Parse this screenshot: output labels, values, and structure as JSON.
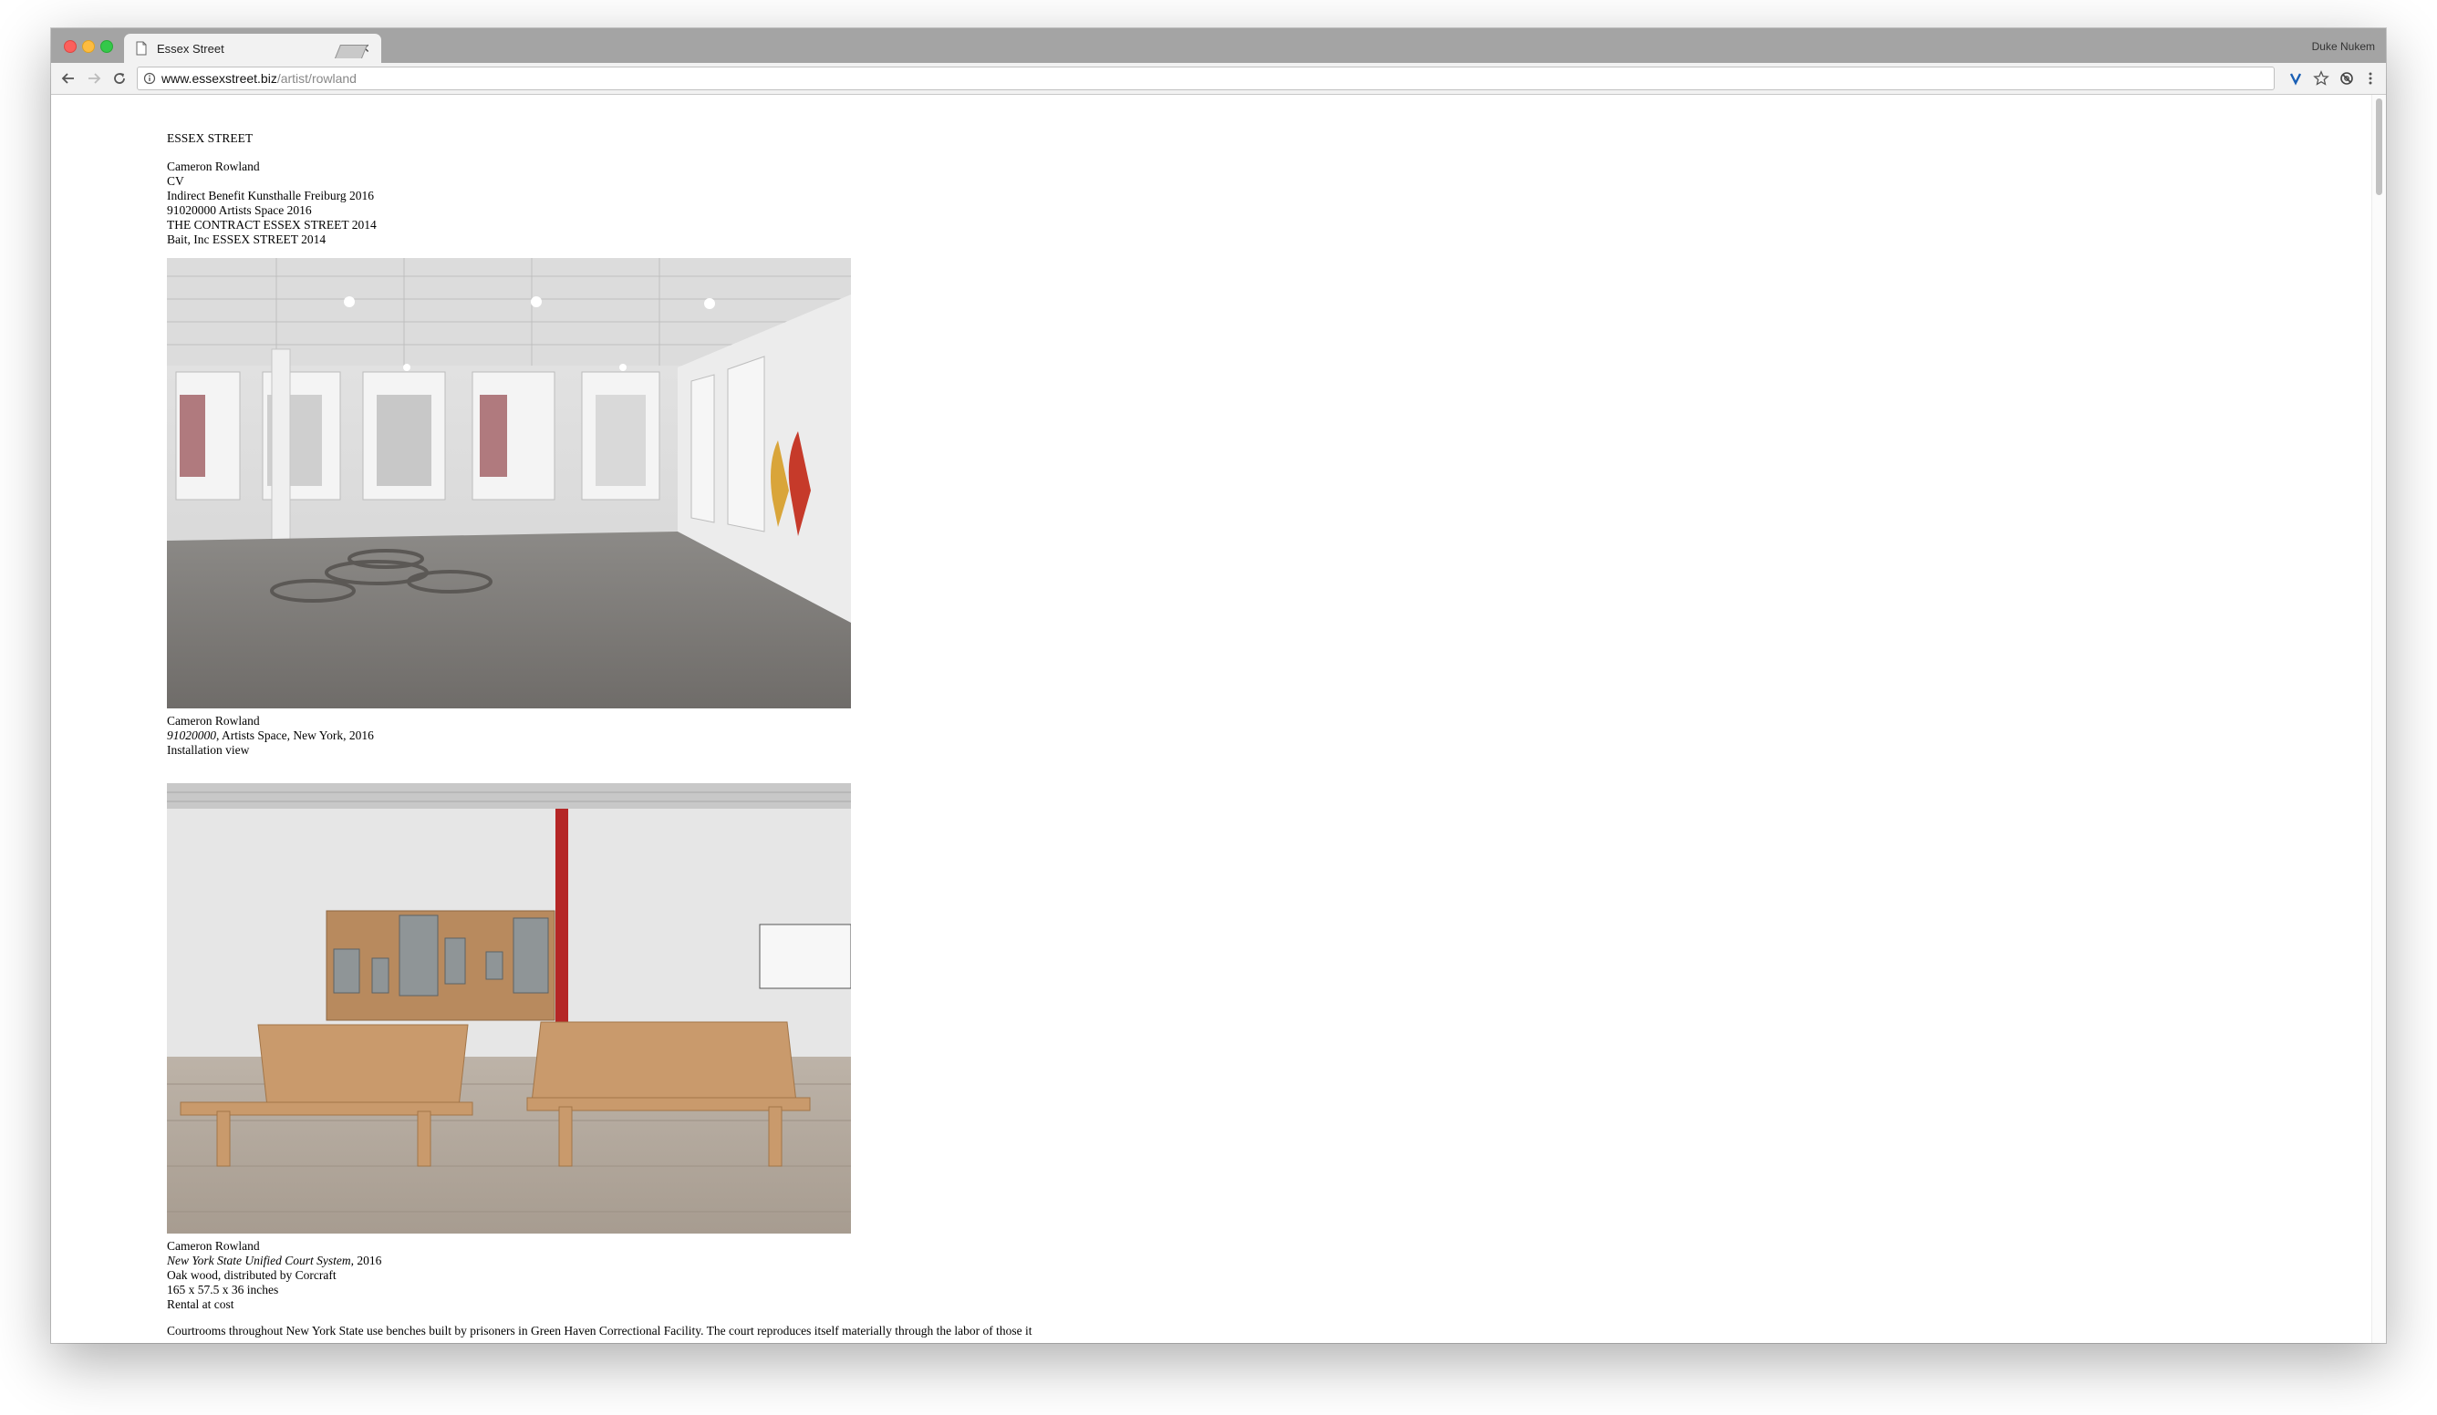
{
  "browser": {
    "tab_title": "Essex Street",
    "profile_name": "Duke Nukem",
    "url_host": "www.essexstreet.biz",
    "url_path": "/artist/rowland"
  },
  "page": {
    "site_title": "ESSEX STREET",
    "artist_nav": [
      "Cameron Rowland",
      "CV",
      "Indirect Benefit Kunsthalle Freiburg 2016",
      "91020000 Artists Space 2016",
      "THE CONTRACT ESSEX STREET 2014",
      "Bait, Inc ESSEX STREET 2014"
    ],
    "works": [
      {
        "artist": "Cameron Rowland",
        "title_italic": "91020000",
        "title_rest": ", Artists Space, New York, 2016",
        "lines": [
          "Installation view"
        ]
      },
      {
        "artist": "Cameron Rowland",
        "title_italic": "New York State Unified Court System",
        "title_rest": ", 2016",
        "lines": [
          "Oak wood, distributed by Corcraft",
          "165 x 57.5 x 36 inches",
          "Rental at cost"
        ]
      }
    ],
    "paragraph": "Courtrooms throughout New York State use benches built by prisoners in Green Haven Correctional Facility. The court reproduces itself materially through the labor of those it"
  },
  "icons": {
    "tab": "document-icon",
    "close": "close-icon",
    "back": "back-arrow-icon",
    "forward": "forward-arrow-icon",
    "reload": "reload-icon",
    "info": "info-icon",
    "extension": "v-extension-icon",
    "star": "star-icon",
    "extension2": "shield-extension-icon",
    "menu": "kebab-menu-icon"
  }
}
